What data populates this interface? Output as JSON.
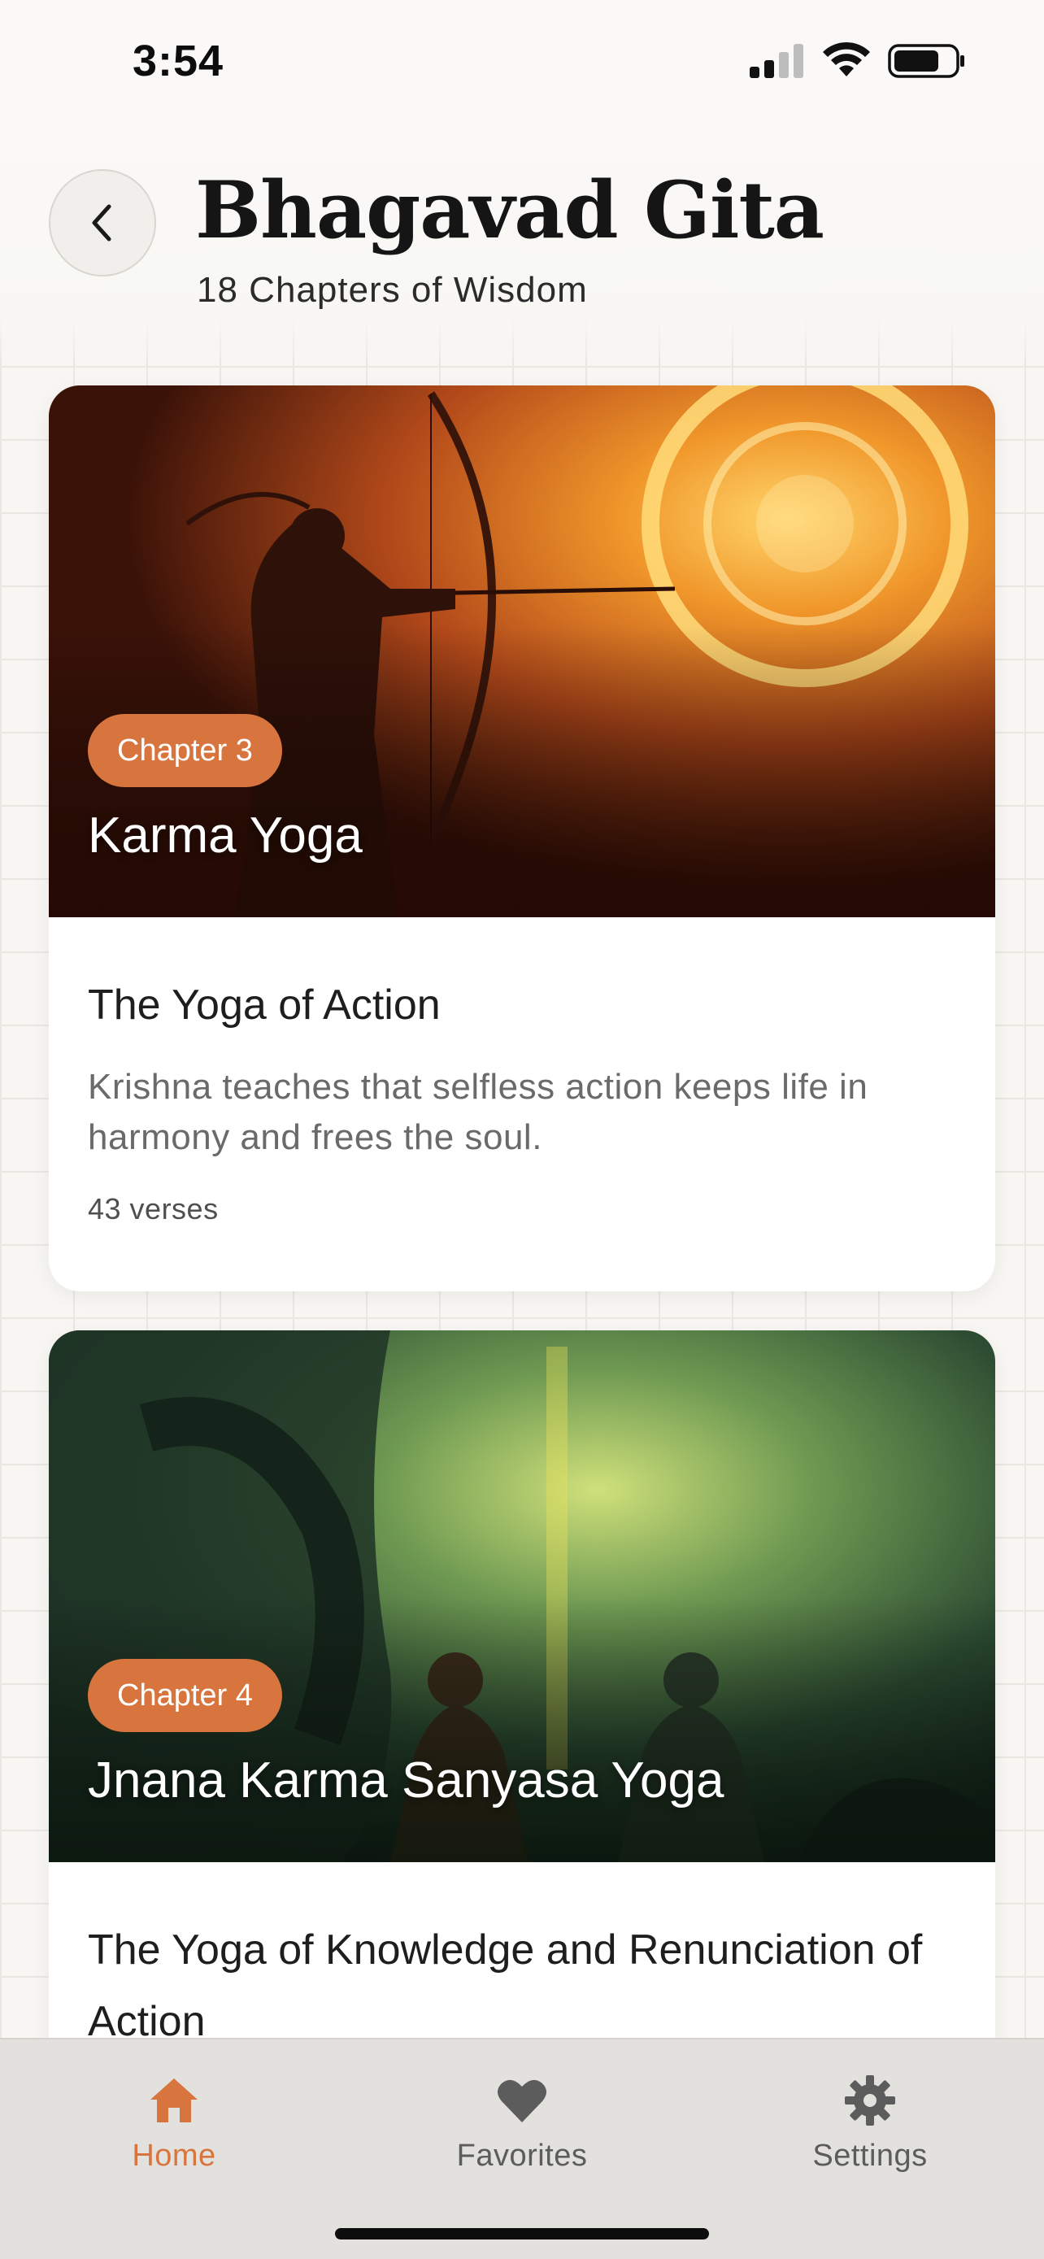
{
  "status_bar": {
    "time": "3:54"
  },
  "header": {
    "title": "Bhagavad Gita",
    "subtitle": "18 Chapters of Wisdom"
  },
  "chapters": [
    {
      "badge": "Chapter 3",
      "name": "Karma Yoga",
      "subtitle": "The Yoga of Action",
      "description": "Krishna teaches that selfless action keeps life in harmony and frees the soul.",
      "verses": "43 verses"
    },
    {
      "badge": "Chapter 4",
      "name": "Jnana Karma Sanyasa Yoga",
      "subtitle": "The Yoga of Knowledge and Renunciation of Action"
    }
  ],
  "bottom_nav": {
    "items": [
      {
        "label": "Home",
        "icon": "home-icon",
        "active": true
      },
      {
        "label": "Favorites",
        "icon": "heart-icon",
        "active": false
      },
      {
        "label": "Settings",
        "icon": "gear-icon",
        "active": false
      }
    ]
  },
  "colors": {
    "accent": "#d8743d",
    "background": "#f7f6f3",
    "card": "#ffffff",
    "nav_background": "#e2e1de"
  }
}
